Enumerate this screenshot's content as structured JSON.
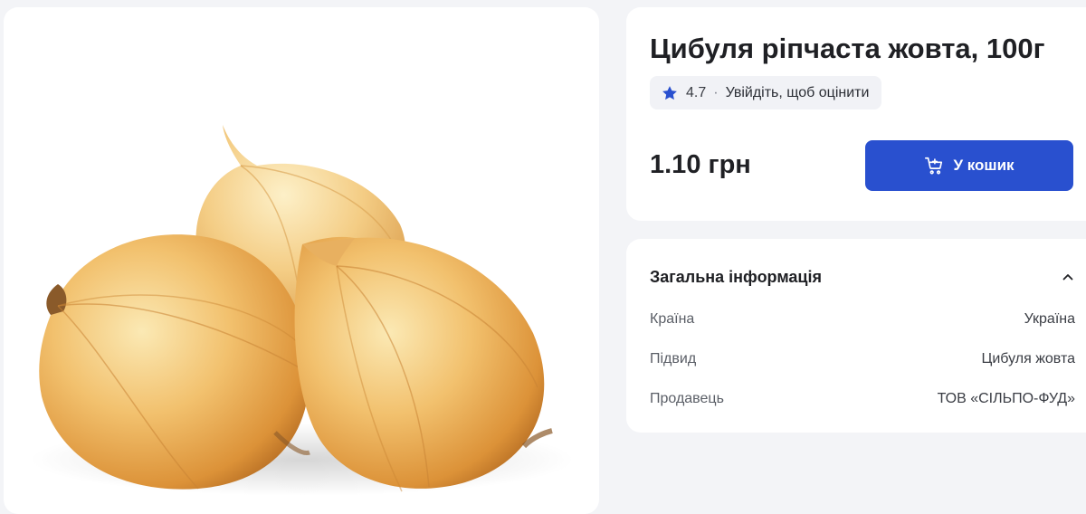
{
  "product": {
    "title": "Цибуля ріпчаста жовта, 100г",
    "image_icon": "onion-photo",
    "rating": {
      "icon": "star-icon",
      "value": "4.7",
      "separator": "·",
      "login_prompt": "Увійдіть, щоб оцінити"
    },
    "price": "1.10 грн",
    "cart_button": {
      "icon": "cart-plus-icon",
      "label": "У кошик"
    }
  },
  "general_info": {
    "title": "Загальна інформація",
    "toggle_icon": "chevron-up-icon",
    "rows": [
      {
        "label": "Країна",
        "value": "Україна"
      },
      {
        "label": "Підвид",
        "value": "Цибуля жовта"
      },
      {
        "label": "Продавець",
        "value": "ТОВ «СІЛЬПО-ФУД»"
      }
    ]
  },
  "colors": {
    "accent": "#2950cf",
    "star": "#2950cf",
    "page_background": "#f3f4f7",
    "card_background": "#ffffff"
  }
}
